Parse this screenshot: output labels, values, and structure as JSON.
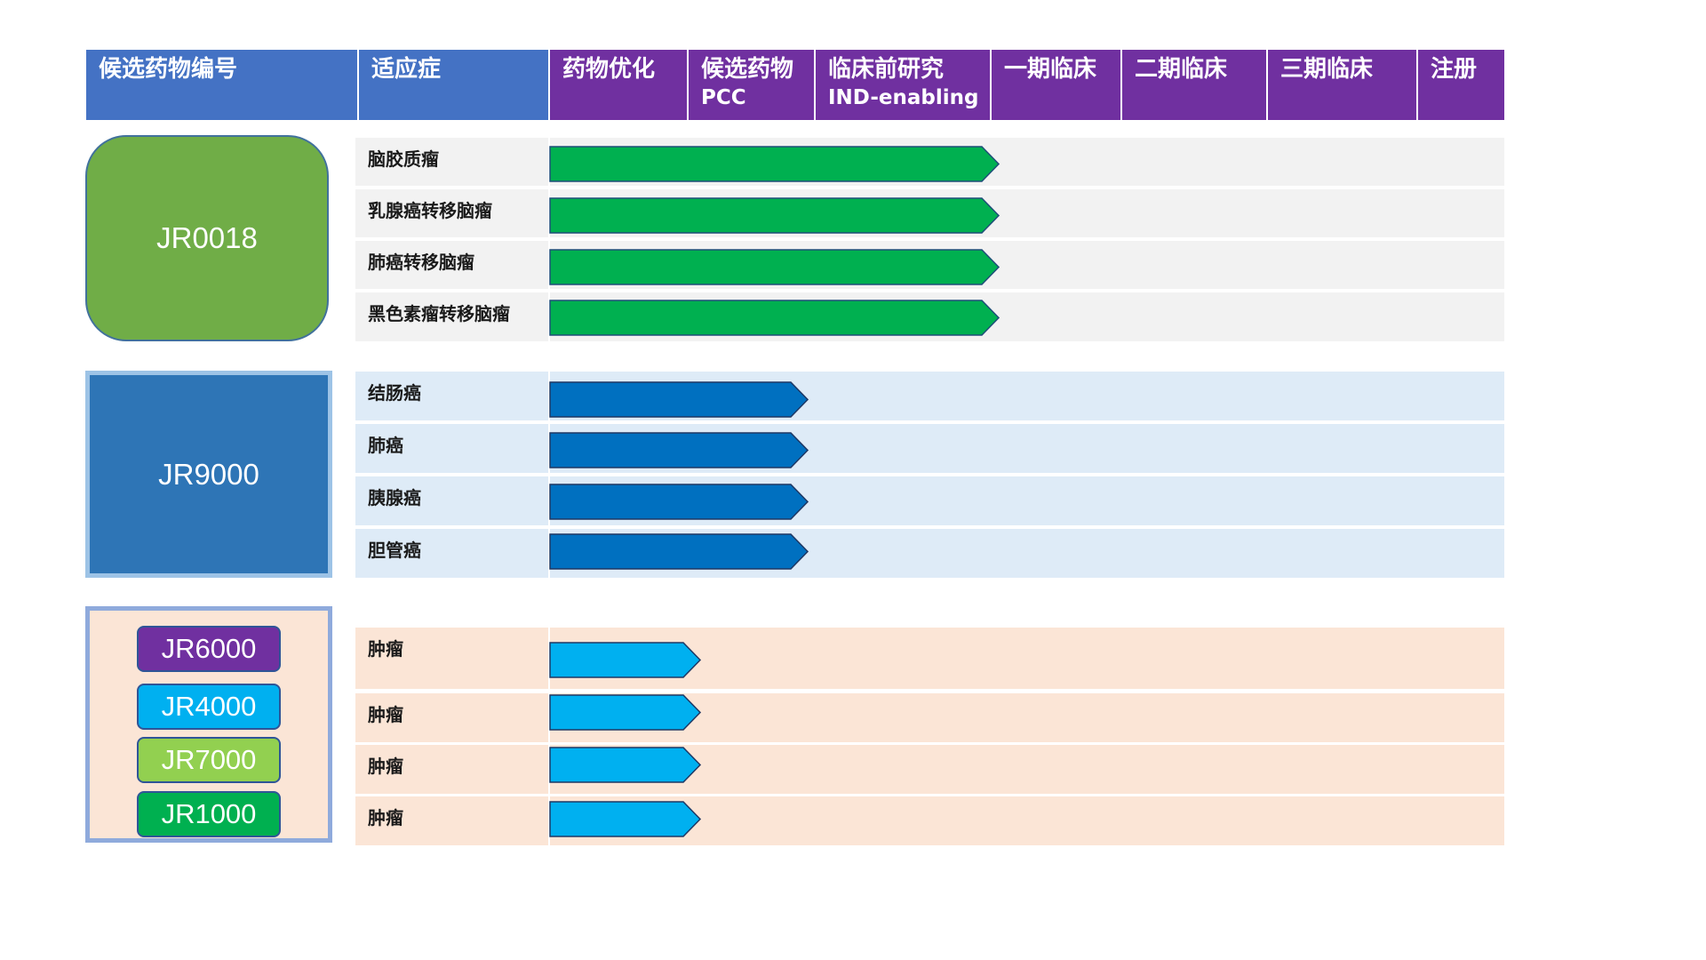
{
  "colors": {
    "header_blue": "#4472c4",
    "header_purple": "#7030a0",
    "arrow_green": "#00b050",
    "arrow_blue": "#0070c0",
    "arrow_cyan": "#00b0f0",
    "row_grey": "#f2f2f2",
    "row_light_blue": "#deebf7",
    "row_peach": "#fbe5d6"
  },
  "header": {
    "candidate": "候选药物编号",
    "indication": "适应症",
    "stages": [
      {
        "label": "药物优化",
        "sub": ""
      },
      {
        "label": "候选药物",
        "sub": "PCC"
      },
      {
        "label": "临床前研究",
        "sub": "IND-enabling"
      },
      {
        "label": "一期临床",
        "sub": ""
      },
      {
        "label": "二期临床",
        "sub": ""
      },
      {
        "label": "三期临床",
        "sub": ""
      },
      {
        "label": "注册",
        "sub": ""
      }
    ]
  },
  "groups": [
    {
      "candidates": [
        "JR0018"
      ],
      "indications": [
        "脑胶质瘤",
        "乳腺癌转移脑瘤",
        "肺癌转移脑瘤",
        "黑色素瘤转移脑瘤"
      ]
    },
    {
      "candidates": [
        "JR9000"
      ],
      "indications": [
        "结肠癌",
        "肺癌",
        "胰腺癌",
        "胆管癌"
      ]
    },
    {
      "candidates": [
        "JR6000",
        "JR4000",
        "JR7000",
        "JR1000"
      ],
      "candidate_colors": [
        "#7030a0",
        "#00b0f0",
        "#92d050",
        "#00b050"
      ],
      "indications": [
        "肿瘤",
        "肿瘤",
        "肿瘤",
        "肿瘤"
      ]
    }
  ],
  "progress": [
    {
      "stage": "临床前研究",
      "fraction_of_stage": 1.0
    },
    {
      "stage": "候选药物",
      "fraction_of_stage": 0.95
    },
    {
      "stage": "药物优化",
      "fraction_of_stage": 1.0
    }
  ]
}
